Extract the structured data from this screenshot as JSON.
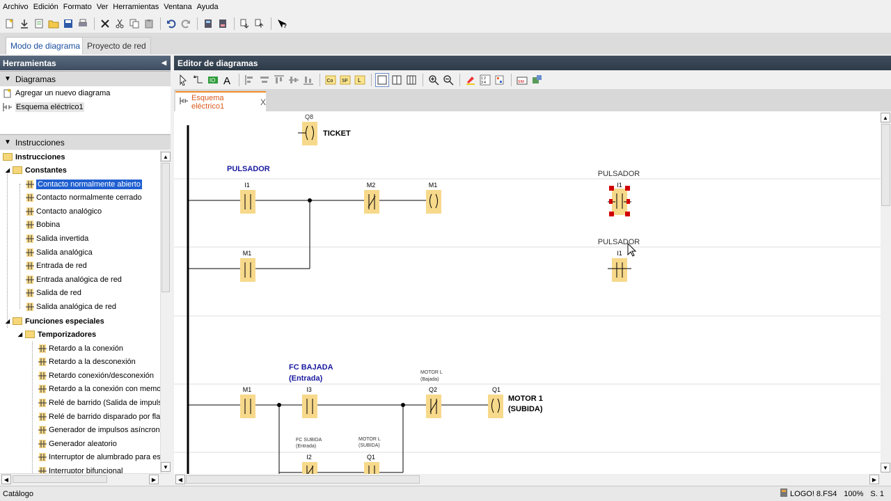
{
  "menu": [
    "Archivo",
    "Edición",
    "Formato",
    "Ver",
    "Herramientas",
    "Ventana",
    "Ayuda"
  ],
  "mode_tabs": {
    "active": "Modo de diagrama",
    "inactive": "Proyecto de red"
  },
  "left_panel": {
    "title": "Herramientas",
    "diagrams_section": "Diagramas",
    "diagram_items": [
      "Agregar un nuevo diagrama",
      "Esquema eléctrico1"
    ],
    "instructions_section": "Instrucciones",
    "tree": {
      "root": "Instrucciones",
      "constants": "Constantes",
      "constant_items": [
        "Contacto normalmente abierto",
        "Contacto normalmente cerrado",
        "Contacto analógico",
        "Bobina",
        "Salida invertida",
        "Salida analógica",
        "Entrada de red",
        "Entrada analógica de red",
        "Salida de red",
        "Salida analógica de red"
      ],
      "special": "Funciones especiales",
      "timers": "Temporizadores",
      "timer_items": [
        "Retardo a la conexión",
        "Retardo a la desconexión",
        "Retardo conexión/desconexión",
        "Retardo a la conexión con memoria",
        "Relé de barrido (Salida de impulsos",
        "Relé de barrido disparado por flanc",
        "Generador de impulsos asíncrono",
        "Generador aleatorio",
        "Interruptor de alumbrado para esc",
        "Interruptor bifuncional"
      ]
    }
  },
  "editor": {
    "title": "Editor de diagramas",
    "tab": "Esquema eléctrico1",
    "tab_close": "X",
    "diagram": {
      "ticket_coil_addr": "Q8",
      "ticket_label": "TICKET",
      "pulsador_label": "PULSADOR",
      "contact_i1": "I1",
      "contact_m2": "M2",
      "coil_m1": "M1",
      "contact_m1": "M1",
      "right_pulsador_1": "PULSADOR",
      "right_pulsador_2": "PULSADOR",
      "right_i1_a": "I1",
      "right_i1_b": "I1",
      "fc_bajada_1": "FC BAJADA",
      "fc_bajada_2": "(Entrada)",
      "motor_l_bajada_1": "MOTOR L",
      "motor_l_bajada_2": "(Bajada)",
      "row3_m1": "M1",
      "row3_i3": "I3",
      "row3_q2": "Q2",
      "row3_q1": "Q1",
      "motor1_1": "MOTOR 1",
      "motor1_2": "(SUBIDA)",
      "fc_subida_1": "FC SUBIDA",
      "fc_subida_2": "(Entrada)",
      "motor_l_subida_1": "MOTOR L",
      "motor_l_subida_2": "(SUBIDA)",
      "row4_i2": "I2",
      "row4_q1": "Q1"
    }
  },
  "status": {
    "left": "Catálogo",
    "device": "LOGO! 8.FS4",
    "zoom": "100%",
    "page": "S. 1"
  },
  "colors": {
    "element_fill": "#f7d98b",
    "selection": "#d10000",
    "tab_accent": "#f28c28",
    "link_text": "#1a1aa0"
  }
}
